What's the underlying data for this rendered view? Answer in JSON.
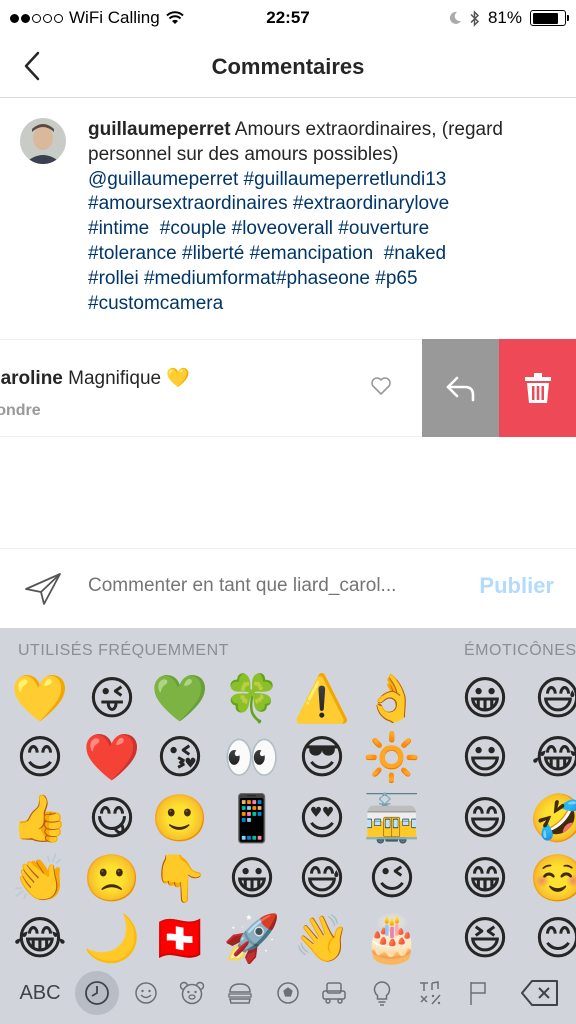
{
  "status_bar": {
    "carrier": "WiFi Calling",
    "time": "22:57",
    "battery": "81%",
    "battery_level": 0.81
  },
  "header": {
    "title": "Commentaires"
  },
  "caption": {
    "username": "guillaumeperret",
    "text": "Amours extraordinaires, (regard personnel sur des amours possibles)",
    "hashtag_lines": [
      "@guillaumeperret #guillaumeperretlundi13",
      "#amoursextraordinaires #extraordinarylove",
      "#intime  #couple #loveoverall #ouverture",
      "#tolerance #liberté #emancipation  #naked",
      "#rollei #mediumformat#phaseone #p65",
      "#customcamera"
    ]
  },
  "comment": {
    "username": "caroline",
    "text": "Magnifique",
    "emoji": "💛",
    "reply_label": "Répondre"
  },
  "composer": {
    "placeholder": "Commenter en tant que liard_carol...",
    "publish_label": "Publier"
  },
  "keyboard": {
    "section_frequent": "UTILISÉS FRÉQUEMMENT",
    "section_emoticons": "ÉMOTICÔNES",
    "abc_label": "ABC",
    "emoji_rows": [
      [
        "💛",
        "😜",
        "💚",
        "🍀",
        "⚠️",
        "👌",
        "😀",
        "😅"
      ],
      [
        "😊",
        "❤️",
        "😘",
        "👀",
        "😎",
        "🔆",
        "😃",
        "😂"
      ],
      [
        "👍",
        "😋",
        "🙂",
        "📱",
        "😍",
        "🚋",
        "😄",
        "🤣"
      ],
      [
        "👏",
        "🙁",
        "👇",
        "😀",
        "😅",
        "😉",
        "😁",
        "☺️"
      ],
      [
        "😂",
        "🌙",
        "🇨🇭",
        "🚀",
        "👋",
        "🎂",
        "😆",
        "😊"
      ]
    ]
  }
}
